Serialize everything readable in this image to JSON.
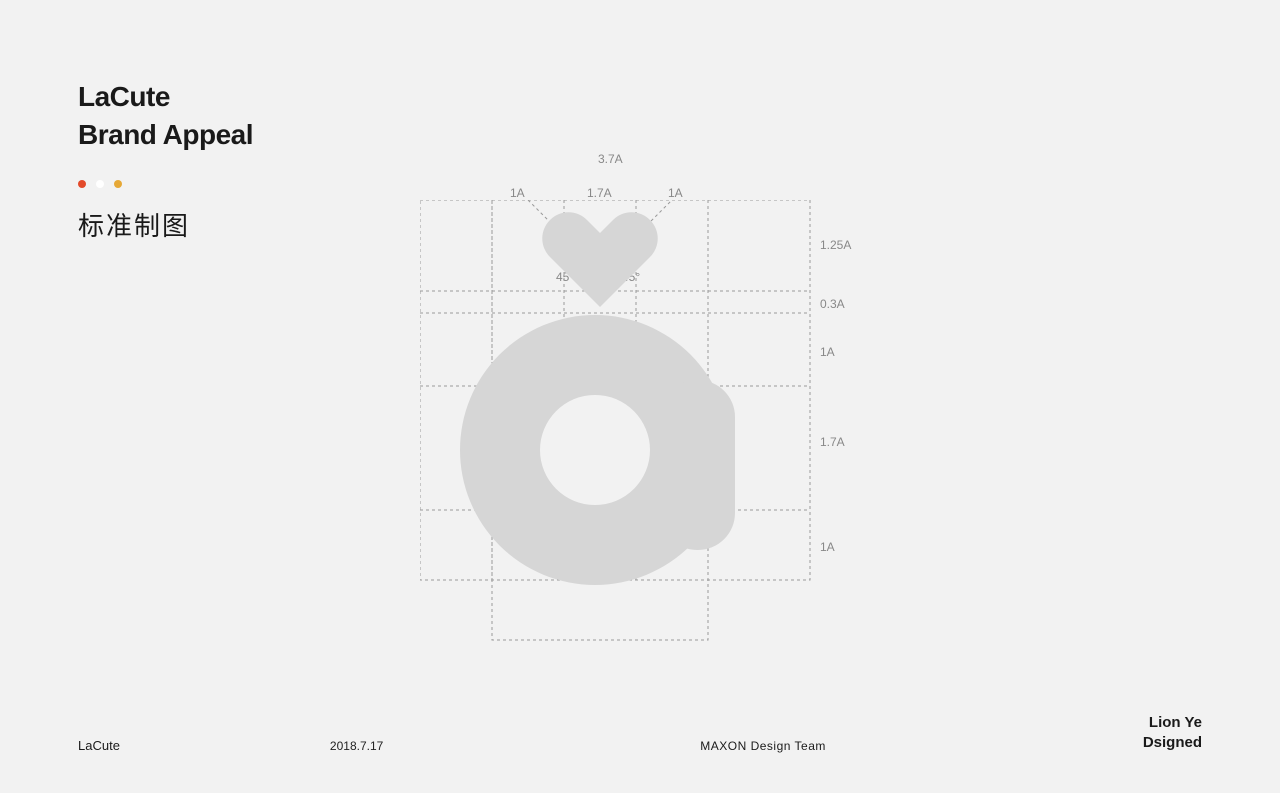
{
  "title": {
    "line1": "LaCute",
    "line2": "Brand Appeal"
  },
  "dots": [
    "#e34a2a",
    "#ffffff",
    "#e6a836"
  ],
  "subtitle": "标准制图",
  "dimensions": {
    "top_total": "3.7A",
    "top_left": "1A",
    "top_mid": "1.7A",
    "top_right": "1A",
    "angle_left": "45°",
    "angle_right": "45°",
    "row1": "1.25A",
    "row2": "0.3A",
    "row3": "1A",
    "row4": "1.7A",
    "row5": "1A"
  },
  "footer": {
    "brand": "LaCute",
    "date": "2018.7.17",
    "team": "MAXON Design Team",
    "author_line1": "Lion Ye",
    "author_line2": "Dsigned"
  }
}
